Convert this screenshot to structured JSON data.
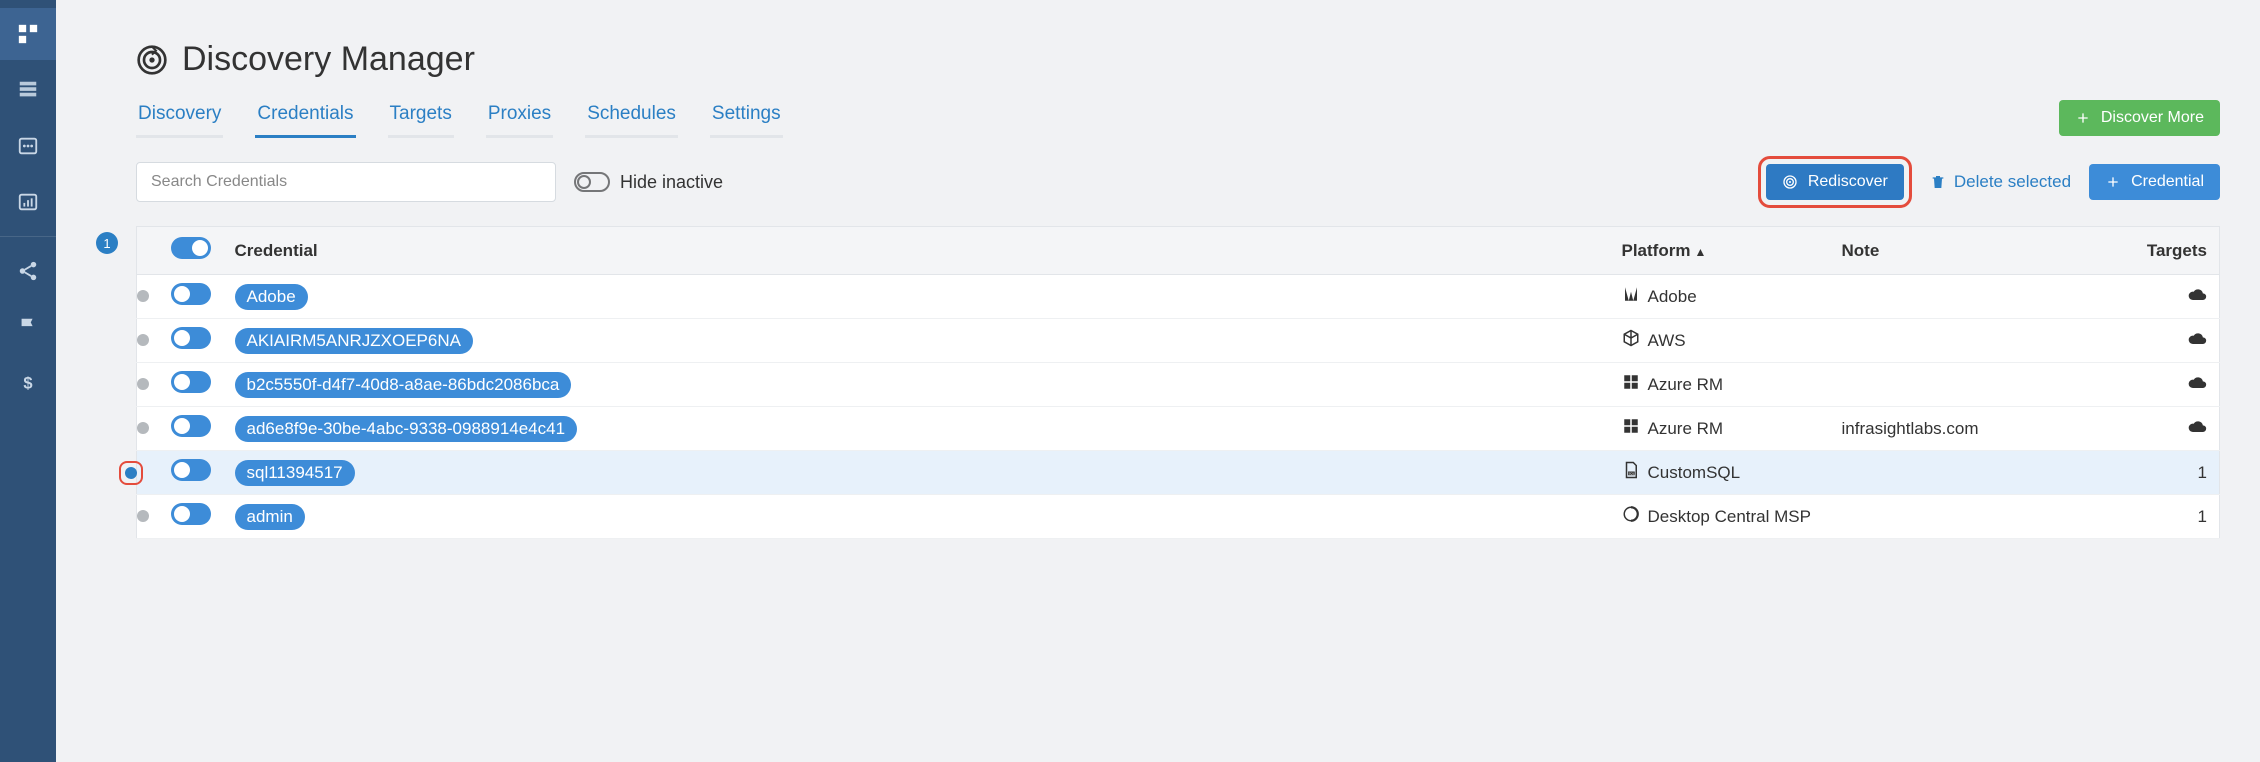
{
  "page": {
    "title": "Discovery Manager"
  },
  "tabs": {
    "items": [
      "Discovery",
      "Credentials",
      "Targets",
      "Proxies",
      "Schedules",
      "Settings"
    ],
    "active_index": 1
  },
  "actions": {
    "discover_more": "Discover More",
    "rediscover": "Rediscover",
    "delete_selected": "Delete selected",
    "new_credential": "Credential"
  },
  "search": {
    "placeholder": "Search Credentials"
  },
  "hide_inactive": {
    "label": "Hide inactive",
    "on": false
  },
  "table": {
    "selected_count": "1",
    "headers": {
      "credential": "Credential",
      "platform": "Platform",
      "note": "Note",
      "targets": "Targets"
    },
    "rows": [
      {
        "name": "Adobe",
        "platform": "Adobe",
        "icon": "adobe",
        "note": "",
        "targets_icon": "cloud",
        "targets": "",
        "selected": false,
        "status": "inactive"
      },
      {
        "name": "AKIAIRM5ANRJZXOEP6NA",
        "platform": "AWS",
        "icon": "cube",
        "note": "",
        "targets_icon": "cloud",
        "targets": "",
        "selected": false,
        "status": "inactive"
      },
      {
        "name": "b2c5550f-d4f7-40d8-a8ae-86bdc2086bca",
        "platform": "Azure RM",
        "icon": "windows",
        "note": "",
        "targets_icon": "cloud",
        "targets": "",
        "selected": false,
        "status": "inactive"
      },
      {
        "name": "ad6e8f9e-30be-4abc-9338-0988914e4c41",
        "platform": "Azure RM",
        "icon": "windows",
        "note": "infrasightlabs.com",
        "targets_icon": "cloud",
        "targets": "",
        "selected": false,
        "status": "inactive"
      },
      {
        "name": "sql11394517",
        "platform": "CustomSQL",
        "icon": "sql",
        "note": "",
        "targets_icon": "",
        "targets": "1",
        "selected": true,
        "status": "active",
        "highlighted": true
      },
      {
        "name": "admin",
        "platform": "Desktop Central MSP",
        "icon": "circle",
        "note": "",
        "targets_icon": "",
        "targets": "1",
        "selected": false,
        "status": "inactive"
      }
    ]
  }
}
